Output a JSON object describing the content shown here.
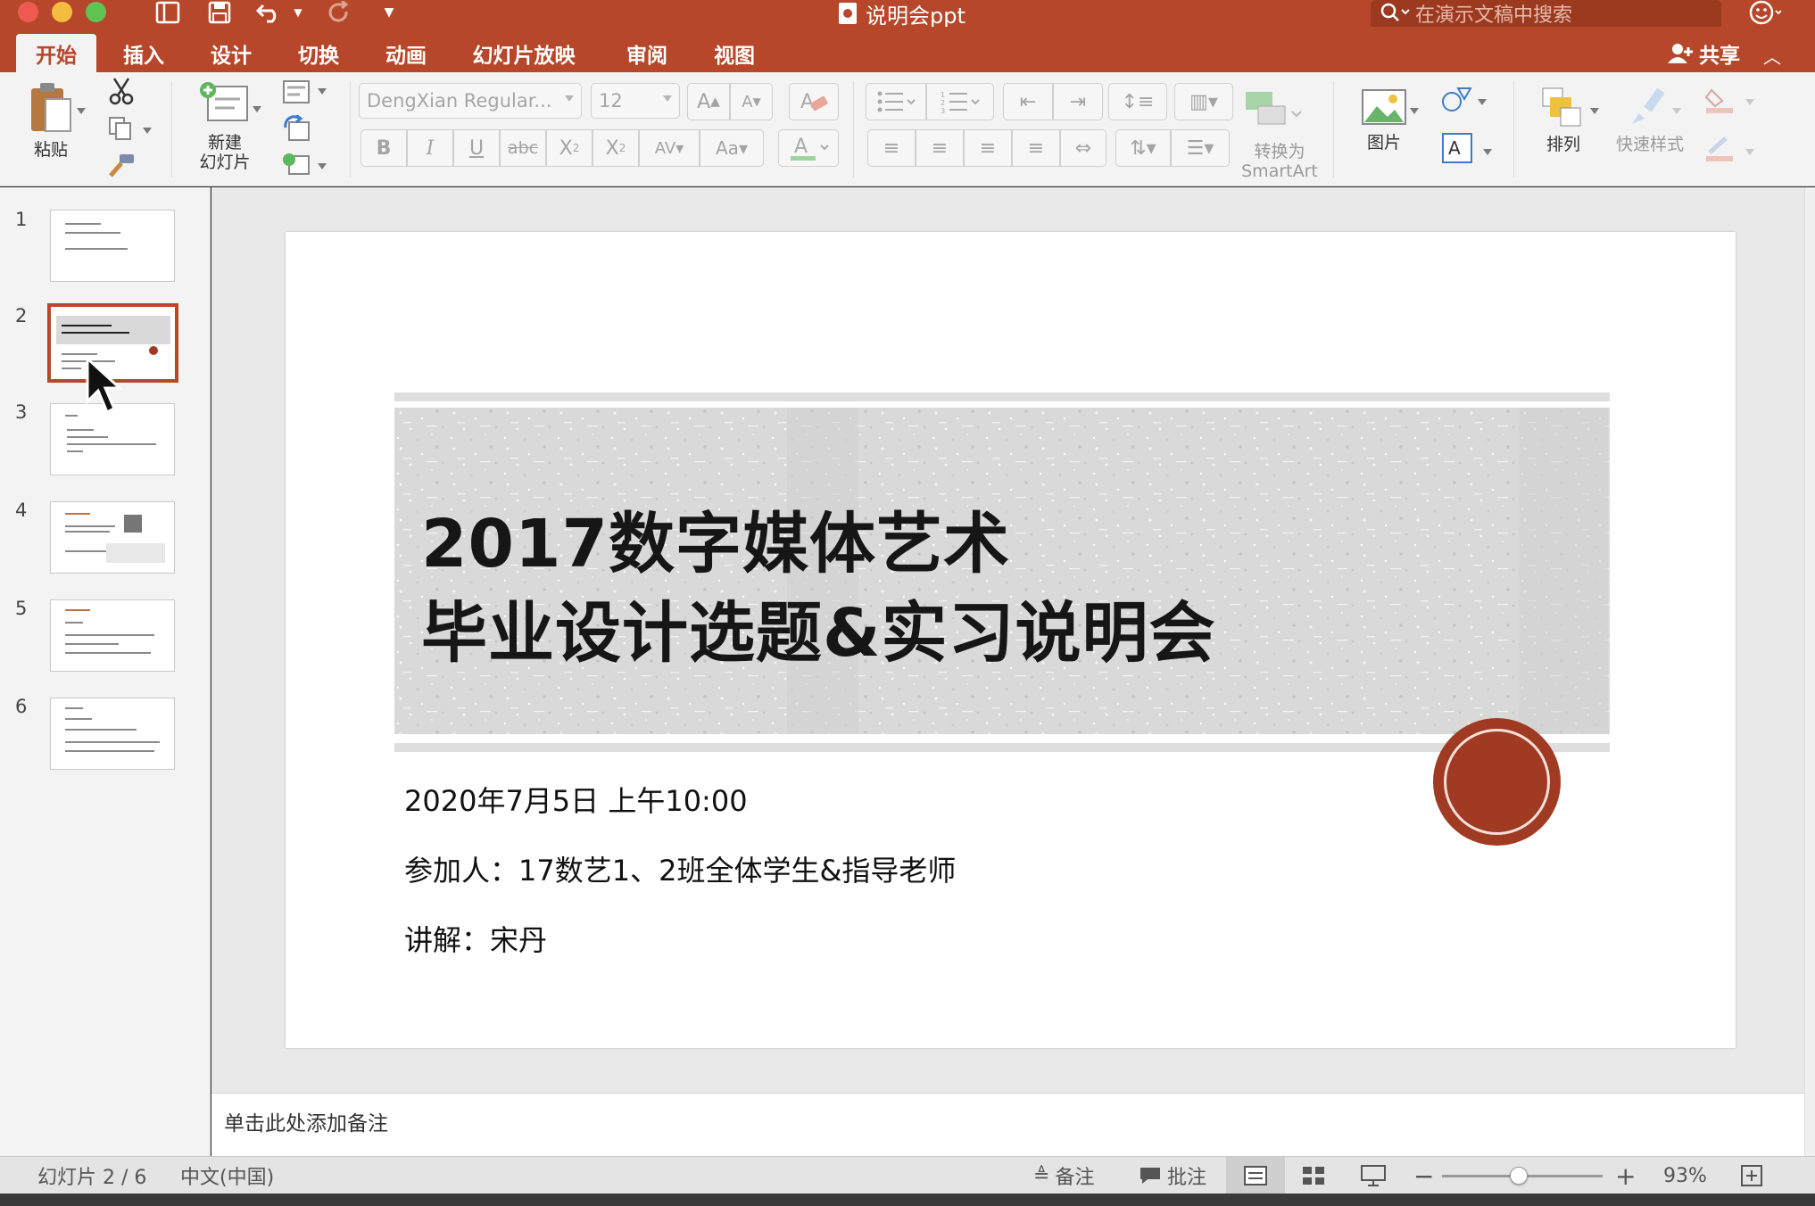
{
  "window": {
    "title": "说明会ppt",
    "search_placeholder": "在演示文稿中搜索"
  },
  "tabs": [
    {
      "label": "开始",
      "active": true
    },
    {
      "label": "插入"
    },
    {
      "label": "设计"
    },
    {
      "label": "切换"
    },
    {
      "label": "动画"
    },
    {
      "label": "幻灯片放映"
    },
    {
      "label": "审阅"
    },
    {
      "label": "视图"
    }
  ],
  "share_label": "共享",
  "ribbon": {
    "paste": "粘贴",
    "new_slide_line1": "新建",
    "new_slide_line2": "幻灯片",
    "font_name": "DengXian Regular...",
    "font_size": "12",
    "bold": "B",
    "italic": "I",
    "underline": "U",
    "strike": "abc",
    "convert_smartart_line1": "转换为",
    "convert_smartart_line2": "SmartArt",
    "picture": "图片",
    "arrange": "排列",
    "quick_styles": "快速样式"
  },
  "thumbnails": [
    {
      "num": "1",
      "selected": false
    },
    {
      "num": "2",
      "selected": true
    },
    {
      "num": "3",
      "selected": false
    },
    {
      "num": "4",
      "selected": false
    },
    {
      "num": "5",
      "selected": false
    },
    {
      "num": "6",
      "selected": false
    }
  ],
  "slide": {
    "title_line1": "2017数字媒体艺术",
    "title_line2": "毕业设计选题&实习说明会",
    "date": "2020年7月5日 上午10:00",
    "participants": "参加人：17数艺1、2班全体学生&指导老师",
    "speaker": "讲解：宋丹"
  },
  "notes_placeholder": "单击此处添加备注",
  "status": {
    "slide_counter": "幻灯片 2 / 6",
    "language": "中文(中国)",
    "notes_btn": "备注",
    "comments_btn": "批注",
    "zoom": "93%",
    "zoom_level": 0.48
  },
  "colors": {
    "accent": "#b7472a",
    "seal": "#a03a22"
  }
}
